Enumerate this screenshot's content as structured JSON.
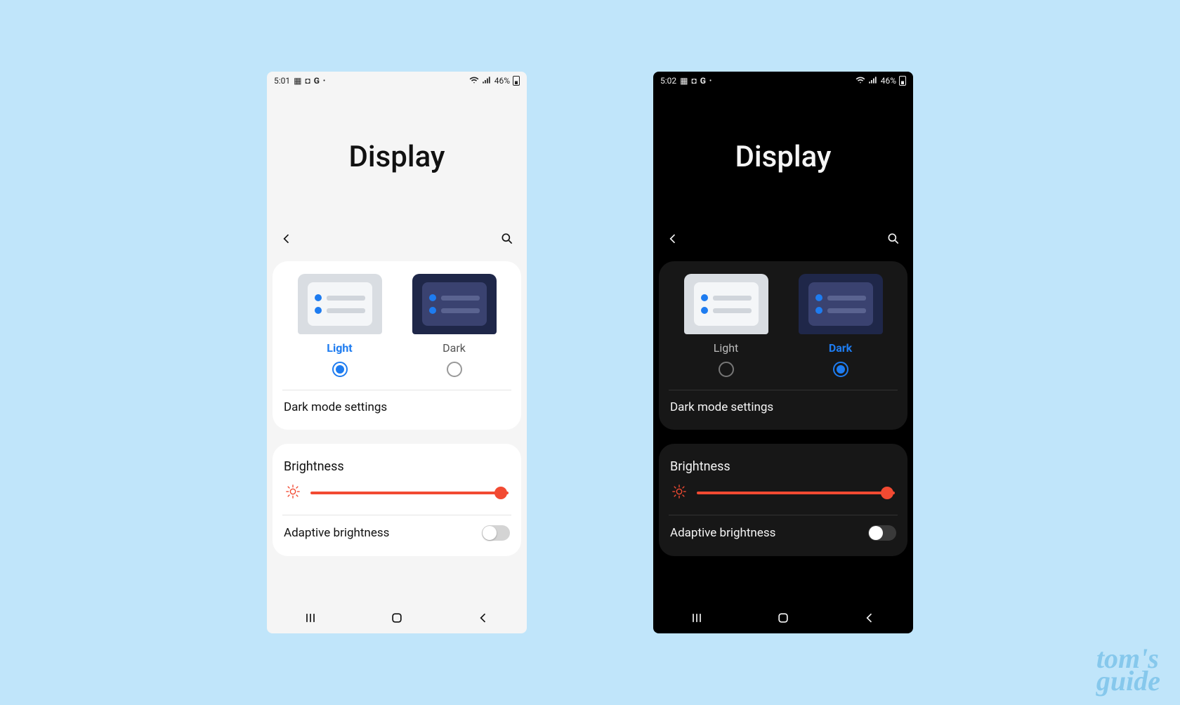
{
  "watermark": {
    "line1": "tom's",
    "line2": "guide"
  },
  "screens": {
    "left": {
      "theme": "light",
      "status": {
        "time": "5:01",
        "battery_pct": "46%"
      },
      "title": "Display",
      "themes": {
        "light_label": "Light",
        "dark_label": "Dark",
        "selected": "light"
      },
      "dark_mode_settings": "Dark mode settings",
      "brightness": {
        "title": "Brightness",
        "value_pct": 96
      },
      "adaptive": {
        "label": "Adaptive brightness",
        "enabled": false
      }
    },
    "right": {
      "theme": "dark",
      "status": {
        "time": "5:02",
        "battery_pct": "46%"
      },
      "title": "Display",
      "themes": {
        "light_label": "Light",
        "dark_label": "Dark",
        "selected": "dark"
      },
      "dark_mode_settings": "Dark mode settings",
      "brightness": {
        "title": "Brightness",
        "value_pct": 96
      },
      "adaptive": {
        "label": "Adaptive brightness",
        "enabled": false
      }
    }
  }
}
